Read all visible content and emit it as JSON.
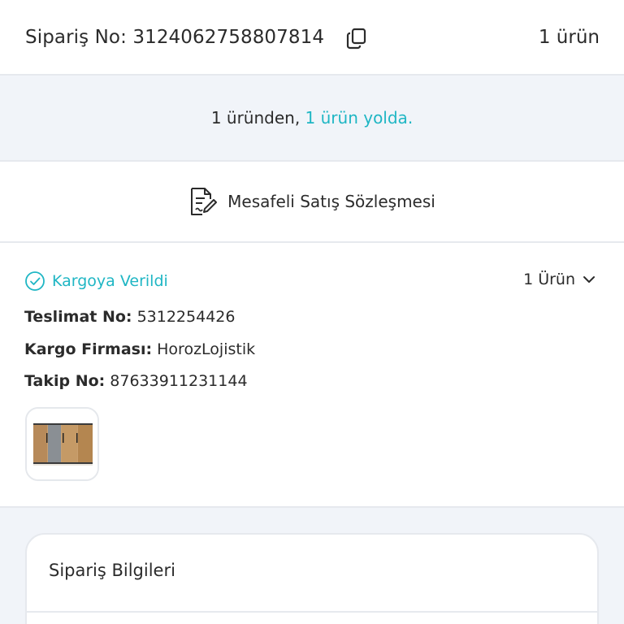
{
  "header": {
    "order_no": "Sipariş No: 3124062758807814",
    "item_count": "1 ürün"
  },
  "status_band": {
    "prefix": "1 üründen, ",
    "accent": "1 ürün yolda."
  },
  "contract": {
    "label": "Mesafeli Satış Sözleşmesi"
  },
  "shipment": {
    "status": "Kargoya Verildi",
    "product_toggle": "1 Ürün",
    "delivery_no_label": "Teslimat No:",
    "delivery_no": "5312254426",
    "carrier_label": "Kargo Firması:",
    "carrier": "HorozLojistik",
    "tracking_label": "Takip No:",
    "tracking_no": "87633911231144"
  },
  "order_info": {
    "title": "Sipariş Bilgileri"
  },
  "colors": {
    "accent": "#1fb6c4",
    "band_bg": "#f1f4f9",
    "divider": "#e6e9ee",
    "text": "#2b2b2b"
  },
  "icons": [
    "copy-icon",
    "document-edit-icon",
    "check-circle-icon",
    "chevron-down-icon"
  ]
}
